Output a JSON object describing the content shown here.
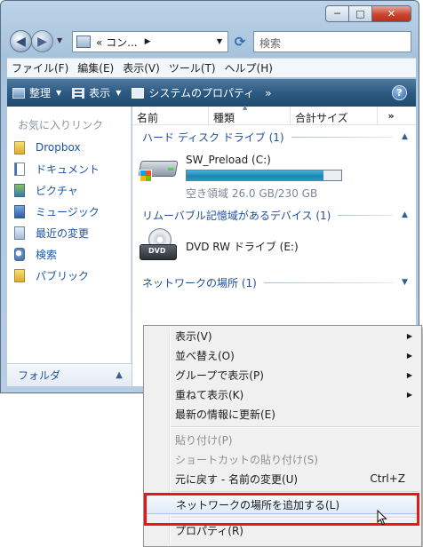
{
  "window": {
    "controls": {
      "minimize": "─",
      "maximize": "□",
      "close": "✕"
    }
  },
  "nav": {
    "back_icon": "back-arrow-icon",
    "forward_icon": "forward-arrow-icon",
    "address_text": "« コン...",
    "search_placeholder": "検索"
  },
  "menubar": {
    "items": [
      "ファイル(F)",
      "編集(E)",
      "表示(V)",
      "ツール(T)",
      "ヘルプ(H)"
    ]
  },
  "commandbar": {
    "organize": "整理",
    "views": "表示",
    "system_properties": "システムのプロパティ",
    "more": "»",
    "help": "?"
  },
  "navpane": {
    "header": "お気に入りリンク",
    "items": [
      {
        "label": "Dropbox",
        "icon": "folder-icon"
      },
      {
        "label": "ドキュメント",
        "icon": "documents-icon"
      },
      {
        "label": "ピクチャ",
        "icon": "pictures-icon"
      },
      {
        "label": "ミュージック",
        "icon": "music-icon"
      },
      {
        "label": "最近の変更",
        "icon": "recent-changes-icon"
      },
      {
        "label": "検索",
        "icon": "search-folder-icon"
      },
      {
        "label": "パブリック",
        "icon": "folder-icon"
      }
    ],
    "folders": "フォルダ"
  },
  "content": {
    "columns": [
      "名前",
      "種類",
      "合計サイズ",
      "»"
    ],
    "groups": {
      "hdd": "ハード ディスク ドライブ (1)",
      "removable": "リムーバブル記憶域があるデバイス (1)",
      "network": "ネットワークの場所 (1)"
    },
    "drive_c": {
      "name": "SW_Preload (C:)",
      "space": "空き領域 26.0 GB/230 GB",
      "used_fraction": 0.887
    },
    "drive_e": {
      "name": "DVD RW ドライブ (E:)",
      "badge": "DVD"
    }
  },
  "context_menu": {
    "items": [
      {
        "label": "表示(V)",
        "submenu": true,
        "disabled": false
      },
      {
        "label": "並べ替え(O)",
        "submenu": true,
        "disabled": false
      },
      {
        "label": "グループで表示(P)",
        "submenu": true,
        "disabled": false
      },
      {
        "label": "重ねて表示(K)",
        "submenu": true,
        "disabled": false
      },
      {
        "label": "最新の情報に更新(E)",
        "submenu": false,
        "disabled": false
      },
      {
        "label": "貼り付け(P)",
        "submenu": false,
        "disabled": true
      },
      {
        "label": "ショートカットの貼り付け(S)",
        "submenu": false,
        "disabled": true
      },
      {
        "label": "元に戻す - 名前の変更(U)",
        "shortcut": "Ctrl+Z",
        "submenu": false,
        "disabled": false
      },
      {
        "label": "ネットワークの場所を追加する(L)",
        "submenu": false,
        "disabled": false,
        "highlighted": true
      },
      {
        "label": "プロパティ(R)",
        "submenu": false,
        "disabled": false
      }
    ]
  },
  "colors": {
    "highlight_border": "#ea1717",
    "group_text": "#1e4f9a",
    "link_text": "#1d55a6",
    "drive_fill": "#1d86b3"
  }
}
